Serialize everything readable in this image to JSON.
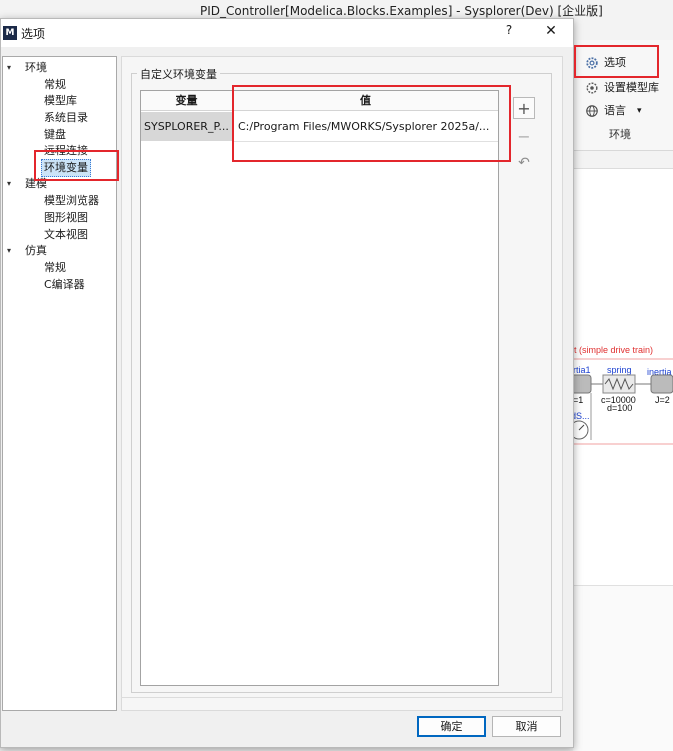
{
  "background_window": {
    "title": "PID_Controller[Modelica.Blocks.Examples] - Sysplorer(Dev) [企业版]",
    "ribbon": {
      "items": [
        {
          "label": "选项",
          "icon": "gear-icon"
        },
        {
          "label": "设置模型库",
          "icon": "library-icon"
        },
        {
          "label": "语言",
          "icon": "globe-icon",
          "suffix": "▾"
        }
      ],
      "group_label": "环境"
    },
    "diagram": {
      "title_text": "nt (simple drive train)",
      "labels": [
        "rtia1",
        "spring",
        "inertia",
        "=1",
        "c=10000",
        "d=100",
        "J=2",
        "dS..."
      ]
    }
  },
  "dialog": {
    "logo": "M",
    "title": "选项",
    "help_label": "?",
    "close_label": "✕",
    "tree": [
      {
        "label": "环境",
        "level": 0,
        "expanded": true
      },
      {
        "label": "常规",
        "level": 1
      },
      {
        "label": "模型库",
        "level": 1
      },
      {
        "label": "系统目录",
        "level": 1
      },
      {
        "label": "键盘",
        "level": 1
      },
      {
        "label": "远程连接",
        "level": 1
      },
      {
        "label": "环境变量",
        "level": 1,
        "selected": true
      },
      {
        "label": "建模",
        "level": 0,
        "expanded": true
      },
      {
        "label": "模型浏览器",
        "level": 1
      },
      {
        "label": "图形视图",
        "level": 1
      },
      {
        "label": "文本视图",
        "level": 1
      },
      {
        "label": "仿真",
        "level": 0,
        "expanded": true
      },
      {
        "label": "常规",
        "level": 1
      },
      {
        "label": "C编译器",
        "level": 1
      }
    ],
    "group_title": "自定义环境变量",
    "table": {
      "columns": [
        "变量",
        "值"
      ],
      "rows": [
        {
          "name": "SYSPLORER_P...",
          "value": "C:/Program Files/MWORKS/Sysplorer 2025a/..."
        }
      ]
    },
    "side_buttons": {
      "add": "+",
      "remove": "−",
      "undo": "↶"
    },
    "ok_label": "确定",
    "cancel_label": "取消"
  },
  "colors": {
    "highlight_box": "#e3262c",
    "accent": "#0067c0",
    "selection": "#cce4f7"
  }
}
